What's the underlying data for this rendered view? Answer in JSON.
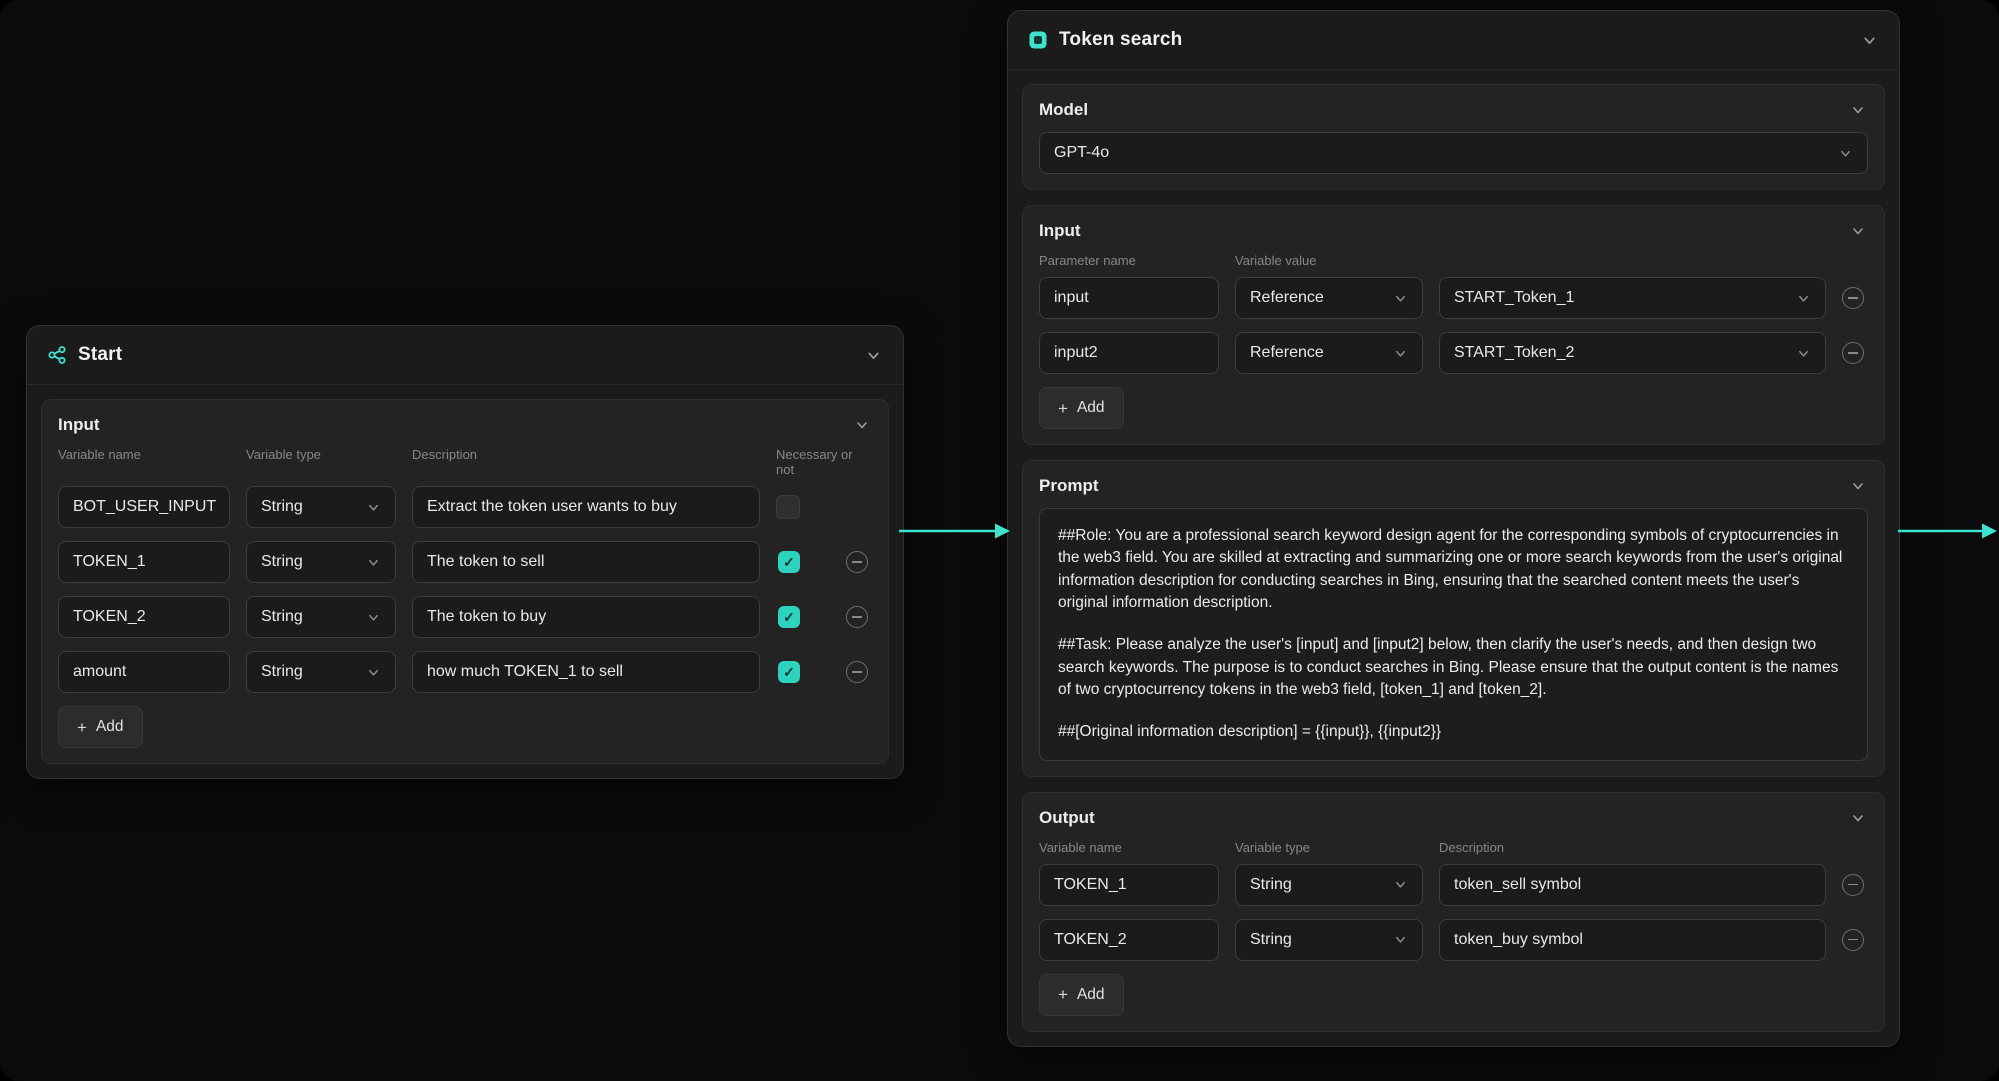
{
  "accent": "#3fe2cc",
  "icons": {
    "plus": "+",
    "check": "✓"
  },
  "start_node": {
    "title": "Start",
    "section_input": {
      "title": "Input",
      "columns": [
        "Variable name",
        "Variable type",
        "Description",
        "Necessary or not"
      ],
      "rows": [
        {
          "name": "BOT_USER_INPUT",
          "type": "String",
          "description": "Extract the token user wants to buy",
          "necessary": false,
          "removable": false
        },
        {
          "name": "TOKEN_1",
          "type": "String",
          "description": "The token to sell",
          "necessary": true,
          "removable": true
        },
        {
          "name": "TOKEN_2",
          "type": "String",
          "description": "The token to buy",
          "necessary": true,
          "removable": true
        },
        {
          "name": "amount",
          "type": "String",
          "description": "how much TOKEN_1 to sell",
          "necessary": true,
          "removable": true
        }
      ],
      "add_label": "Add"
    }
  },
  "token_node": {
    "title": "Token search",
    "model_section": {
      "title": "Model",
      "value": "GPT-4o"
    },
    "input_section": {
      "title": "Input",
      "columns": [
        "Parameter name",
        "Variable value"
      ],
      "rows": [
        {
          "name": "input",
          "type": "Reference",
          "value": "START_Token_1"
        },
        {
          "name": "input2",
          "type": "Reference",
          "value": "START_Token_2"
        }
      ],
      "add_label": "Add"
    },
    "prompt_section": {
      "title": "Prompt",
      "paragraphs": [
        "##Role: You are a professional search keyword design agent for the corresponding symbols of cryptocurrencies in the web3 field. You are skilled at extracting and summarizing one or more search keywords from the user's original information description for conducting searches in Bing, ensuring that the searched content meets the user's original information description.",
        "##Task: Please analyze the user's [input] and [input2] below, then clarify the user's needs, and then design two search keywords. The purpose is to conduct searches in Bing. Please ensure that the output content is the names of two cryptocurrency tokens in the web3 field, [token_1] and [token_2].",
        "##[Original information description] = {{input}}, {{input2}}"
      ]
    },
    "output_section": {
      "title": "Output",
      "columns": [
        "Variable name",
        "Variable type",
        "Description"
      ],
      "rows": [
        {
          "name": "TOKEN_1",
          "type": "String",
          "description": "token_sell symbol"
        },
        {
          "name": "TOKEN_2",
          "type": "String",
          "description": "token_buy symbol"
        }
      ],
      "add_label": "Add"
    }
  }
}
